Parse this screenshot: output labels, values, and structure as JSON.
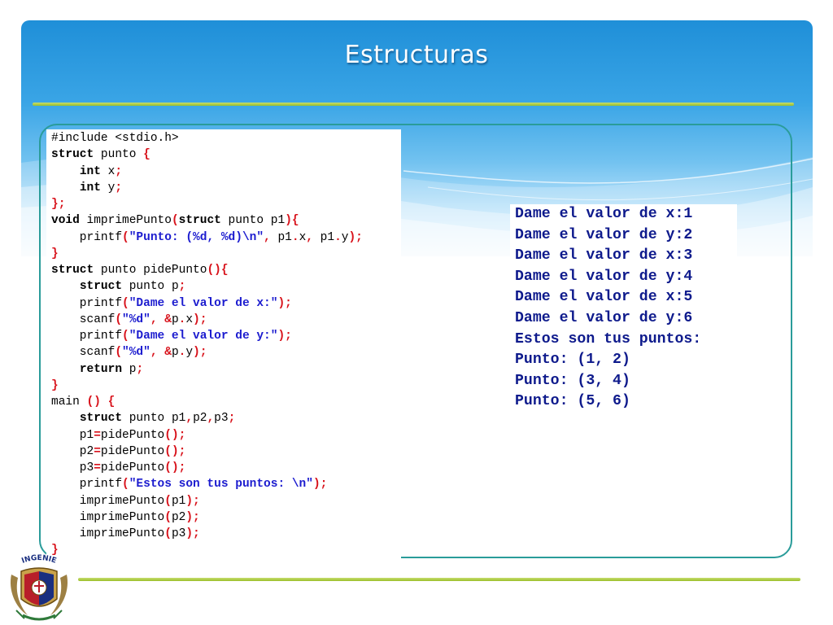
{
  "slide": {
    "title": "Estructuras",
    "colors": {
      "header_blue": "#1f8fd8",
      "rule_green": "#9bbf2a",
      "frame_teal": "#2a9c9a",
      "code_keyword": "#000000",
      "code_string": "#1c1ccf",
      "code_punct": "#d8121b",
      "console_text": "#0e1a8c"
    }
  },
  "code": {
    "lines": [
      [
        {
          "t": "#include <stdio.h>",
          "c": "plain"
        }
      ],
      [
        {
          "t": "struct",
          "c": "kw"
        },
        {
          "t": " punto ",
          "c": "plain"
        },
        {
          "t": "{",
          "c": "pn"
        }
      ],
      [
        {
          "t": "    ",
          "c": "plain"
        },
        {
          "t": "int",
          "c": "kw"
        },
        {
          "t": " x",
          "c": "plain"
        },
        {
          "t": ";",
          "c": "pn"
        }
      ],
      [
        {
          "t": "    ",
          "c": "plain"
        },
        {
          "t": "int",
          "c": "kw"
        },
        {
          "t": " y",
          "c": "plain"
        },
        {
          "t": ";",
          "c": "pn"
        }
      ],
      [
        {
          "t": "};",
          "c": "pn"
        }
      ],
      [
        {
          "t": "void",
          "c": "kw"
        },
        {
          "t": " imprimePunto",
          "c": "plain"
        },
        {
          "t": "(",
          "c": "pn"
        },
        {
          "t": "struct",
          "c": "kw"
        },
        {
          "t": " punto p1",
          "c": "plain"
        },
        {
          "t": "){",
          "c": "pn"
        }
      ],
      [
        {
          "t": "    printf",
          "c": "plain"
        },
        {
          "t": "(",
          "c": "pn"
        },
        {
          "t": "\"Punto: (%d, %d)\\n\"",
          "c": "str"
        },
        {
          "t": ",",
          "c": "pn"
        },
        {
          "t": " p1",
          "c": "plain"
        },
        {
          "t": ".",
          "c": "pn"
        },
        {
          "t": "x",
          "c": "plain"
        },
        {
          "t": ",",
          "c": "pn"
        },
        {
          "t": " p1",
          "c": "plain"
        },
        {
          "t": ".",
          "c": "pn"
        },
        {
          "t": "y",
          "c": "plain"
        },
        {
          "t": ");",
          "c": "pn"
        }
      ],
      [
        {
          "t": "}",
          "c": "pn"
        }
      ],
      [
        {
          "t": "struct",
          "c": "kw"
        },
        {
          "t": " punto pidePunto",
          "c": "plain"
        },
        {
          "t": "(){",
          "c": "pn"
        }
      ],
      [
        {
          "t": "    ",
          "c": "plain"
        },
        {
          "t": "struct",
          "c": "kw"
        },
        {
          "t": " punto p",
          "c": "plain"
        },
        {
          "t": ";",
          "c": "pn"
        }
      ],
      [
        {
          "t": "    printf",
          "c": "plain"
        },
        {
          "t": "(",
          "c": "pn"
        },
        {
          "t": "\"Dame el valor de x:\"",
          "c": "str"
        },
        {
          "t": ");",
          "c": "pn"
        }
      ],
      [
        {
          "t": "    scanf",
          "c": "plain"
        },
        {
          "t": "(",
          "c": "pn"
        },
        {
          "t": "\"%d\"",
          "c": "str"
        },
        {
          "t": ",",
          "c": "pn"
        },
        {
          "t": " ",
          "c": "plain"
        },
        {
          "t": "&",
          "c": "pn"
        },
        {
          "t": "p",
          "c": "plain"
        },
        {
          "t": ".",
          "c": "pn"
        },
        {
          "t": "x",
          "c": "plain"
        },
        {
          "t": ");",
          "c": "pn"
        }
      ],
      [
        {
          "t": "    printf",
          "c": "plain"
        },
        {
          "t": "(",
          "c": "pn"
        },
        {
          "t": "\"Dame el valor de y:\"",
          "c": "str"
        },
        {
          "t": ");",
          "c": "pn"
        }
      ],
      [
        {
          "t": "    scanf",
          "c": "plain"
        },
        {
          "t": "(",
          "c": "pn"
        },
        {
          "t": "\"%d\"",
          "c": "str"
        },
        {
          "t": ",",
          "c": "pn"
        },
        {
          "t": " ",
          "c": "plain"
        },
        {
          "t": "&",
          "c": "pn"
        },
        {
          "t": "p",
          "c": "plain"
        },
        {
          "t": ".",
          "c": "pn"
        },
        {
          "t": "y",
          "c": "plain"
        },
        {
          "t": ");",
          "c": "pn"
        }
      ],
      [
        {
          "t": "    ",
          "c": "plain"
        },
        {
          "t": "return",
          "c": "kw"
        },
        {
          "t": " p",
          "c": "plain"
        },
        {
          "t": ";",
          "c": "pn"
        }
      ],
      [
        {
          "t": "}",
          "c": "pn"
        }
      ],
      [
        {
          "t": "main ",
          "c": "plain"
        },
        {
          "t": "()",
          "c": "pn"
        },
        {
          "t": " ",
          "c": "plain"
        },
        {
          "t": "{",
          "c": "pn"
        }
      ],
      [
        {
          "t": "    ",
          "c": "plain"
        },
        {
          "t": "struct",
          "c": "kw"
        },
        {
          "t": " punto p1",
          "c": "plain"
        },
        {
          "t": ",",
          "c": "pn"
        },
        {
          "t": "p2",
          "c": "plain"
        },
        {
          "t": ",",
          "c": "pn"
        },
        {
          "t": "p3",
          "c": "plain"
        },
        {
          "t": ";",
          "c": "pn"
        }
      ],
      [
        {
          "t": "    p1",
          "c": "plain"
        },
        {
          "t": "=",
          "c": "pn"
        },
        {
          "t": "pidePunto",
          "c": "plain"
        },
        {
          "t": "();",
          "c": "pn"
        }
      ],
      [
        {
          "t": "    p2",
          "c": "plain"
        },
        {
          "t": "=",
          "c": "pn"
        },
        {
          "t": "pidePunto",
          "c": "plain"
        },
        {
          "t": "();",
          "c": "pn"
        }
      ],
      [
        {
          "t": "    p3",
          "c": "plain"
        },
        {
          "t": "=",
          "c": "pn"
        },
        {
          "t": "pidePunto",
          "c": "plain"
        },
        {
          "t": "();",
          "c": "pn"
        }
      ],
      [
        {
          "t": "    printf",
          "c": "plain"
        },
        {
          "t": "(",
          "c": "pn"
        },
        {
          "t": "\"Estos son tus puntos: \\n\"",
          "c": "str"
        },
        {
          "t": ");",
          "c": "pn"
        }
      ],
      [
        {
          "t": "    imprimePunto",
          "c": "plain"
        },
        {
          "t": "(",
          "c": "pn"
        },
        {
          "t": "p1",
          "c": "plain"
        },
        {
          "t": ");",
          "c": "pn"
        }
      ],
      [
        {
          "t": "    imprimePunto",
          "c": "plain"
        },
        {
          "t": "(",
          "c": "pn"
        },
        {
          "t": "p2",
          "c": "plain"
        },
        {
          "t": ");",
          "c": "pn"
        }
      ],
      [
        {
          "t": "    imprimePunto",
          "c": "plain"
        },
        {
          "t": "(",
          "c": "pn"
        },
        {
          "t": "p3",
          "c": "plain"
        },
        {
          "t": ");",
          "c": "pn"
        }
      ],
      [
        {
          "t": "}",
          "c": "pn"
        }
      ]
    ]
  },
  "console": {
    "lines": [
      "Dame el valor de x:1",
      "Dame el valor de y:2",
      "Dame el valor de x:3",
      "Dame el valor de y:4",
      "Dame el valor de x:5",
      "Dame el valor de y:6",
      "Estos son tus puntos:",
      "Punto: (1, 2)",
      "Punto: (3, 4)",
      "Punto: (5, 6)"
    ]
  },
  "logo": {
    "label": "INGENIE",
    "icon": "university-crest-icon"
  }
}
